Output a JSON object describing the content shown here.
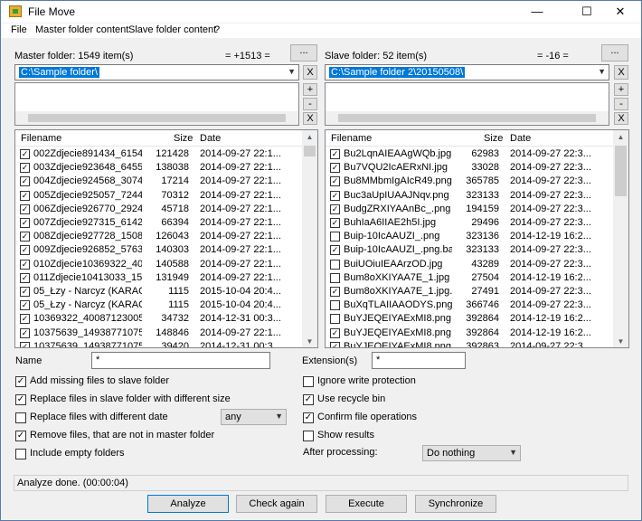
{
  "window": {
    "title": "File Move",
    "minimize": "—",
    "maximize": "☐",
    "close": "✕"
  },
  "menu": [
    "File",
    "Master folder content",
    "Slave folder content",
    "?"
  ],
  "master": {
    "label": "Master folder: 1549 item(s)",
    "diff": "= +1513 =",
    "browse": "...",
    "path": "C:\\Sample folder\\",
    "clear": "X",
    "add": "+",
    "remove": "-",
    "clear_list": "X",
    "columns": [
      "Filename",
      "Size",
      "Date"
    ],
    "rows": [
      {
        "name": "002Zdjecie891434_615438...",
        "size": "121428",
        "date": "2014-09-27 22:1...",
        "checked": true
      },
      {
        "name": "003Zdjecie923648_645541...",
        "size": "138038",
        "date": "2014-09-27 22:1...",
        "checked": true
      },
      {
        "name": "004Zdjecie924568_307462...",
        "size": "17214",
        "date": "2014-09-27 22:1...",
        "checked": true
      },
      {
        "name": "005Zdjecie925057_724465...",
        "size": "70312",
        "date": "2014-09-27 22:1...",
        "checked": true
      },
      {
        "name": "006Zdjecie926770_292458...",
        "size": "45718",
        "date": "2014-09-27 22:1...",
        "checked": true
      },
      {
        "name": "007Zdjecie927315_614202...",
        "size": "66394",
        "date": "2014-09-27 22:1...",
        "checked": true
      },
      {
        "name": "008Zdjecie927728_150864...",
        "size": "126043",
        "date": "2014-09-27 22:1...",
        "checked": true
      },
      {
        "name": "009Zdjecie926852_576333...",
        "size": "140303",
        "date": "2014-09-27 22:1...",
        "checked": true
      },
      {
        "name": "010Zdjecie10369322_4008...",
        "size": "140588",
        "date": "2014-09-27 22:1...",
        "checked": true
      },
      {
        "name": "011Zdjecie10413033_1587...",
        "size": "131949",
        "date": "2014-09-27 22:1...",
        "checked": true
      },
      {
        "name": "05_Łzy - Narcyz (KARAOK...",
        "size": "1115",
        "date": "2015-10-04 20:4...",
        "checked": true
      },
      {
        "name": "05_Łzy - Narcyz (KARAOK...",
        "size": "1115",
        "date": "2015-10-04 20:4...",
        "checked": true
      },
      {
        "name": "10369322_40087123005358...",
        "size": "34732",
        "date": "2014-12-31 00:3...",
        "checked": true
      },
      {
        "name": "10375639_14938771075139...",
        "size": "148846",
        "date": "2014-09-27 22:1...",
        "checked": true
      },
      {
        "name": "10375639_14938771075139...",
        "size": "39420",
        "date": "2014-12-31 00:3...",
        "checked": true
      }
    ]
  },
  "slave": {
    "label": "Slave folder: 52 item(s)",
    "diff": "= -16 =",
    "browse": "...",
    "path": "C:\\Sample folder 2\\20150508\\",
    "clear": "X",
    "add": "+",
    "remove": "-",
    "clear_list": "X",
    "columns": [
      "Filename",
      "Size",
      "Date"
    ],
    "rows": [
      {
        "name": "Bu2LqnAIEAAgWQb.jpg",
        "size": "62983",
        "date": "2014-09-27 22:3...",
        "checked": true
      },
      {
        "name": "Bu7VQU2IcAERxNI.jpg",
        "size": "33028",
        "date": "2014-09-27 22:3...",
        "checked": true
      },
      {
        "name": "Bu8MMbmIgAIcR49.png",
        "size": "365785",
        "date": "2014-09-27 22:3...",
        "checked": true
      },
      {
        "name": "Buc3aUpIUAAJNqv.png",
        "size": "323133",
        "date": "2014-09-27 22:3...",
        "checked": true
      },
      {
        "name": "BudgZRXIYAAnBc_.png",
        "size": "194159",
        "date": "2014-09-27 22:3...",
        "checked": true
      },
      {
        "name": "BuhIaA6IIAE2h5I.jpg",
        "size": "29496",
        "date": "2014-09-27 22:3...",
        "checked": true
      },
      {
        "name": "Buip-10IcAAUZI_.png",
        "size": "323136",
        "date": "2014-12-19 16:2...",
        "checked": false
      },
      {
        "name": "Buip-10IcAAUZI_.png.bak",
        "size": "323133",
        "date": "2014-09-27 22:3...",
        "checked": true
      },
      {
        "name": "BuiUOiuIEAArzOD.jpg",
        "size": "43289",
        "date": "2014-09-27 22:3...",
        "checked": false
      },
      {
        "name": "Bum8oXKIYAA7E_1.jpg",
        "size": "27504",
        "date": "2014-12-19 16:2...",
        "checked": false
      },
      {
        "name": "Bum8oXKIYAA7E_1.jpg.bak",
        "size": "27491",
        "date": "2014-09-27 22:3...",
        "checked": true
      },
      {
        "name": "BuXqTLAIIAAODYS.png",
        "size": "366746",
        "date": "2014-09-27 22:3...",
        "checked": false
      },
      {
        "name": "BuYJEQEIYAExMI8.png",
        "size": "392864",
        "date": "2014-12-19 16:2...",
        "checked": false
      },
      {
        "name": "BuYJEQEIYAExMI8.png.bak",
        "size": "392864",
        "date": "2014-12-19 16:2...",
        "checked": true
      },
      {
        "name": "BuYJEQEIYAExMI8.png.bak",
        "size": "392863",
        "date": "2014-09-27 22:3...",
        "checked": true
      }
    ]
  },
  "filters": {
    "name_label": "Name",
    "name_value": "*",
    "ext_label": "Extension(s)",
    "ext_value": "*"
  },
  "options_left": [
    {
      "label": "Add missing files to slave folder",
      "checked": true
    },
    {
      "label": "Replace files in slave folder with different size",
      "checked": true
    },
    {
      "label": "Replace files with different date",
      "checked": false
    },
    {
      "label": "Remove files, that are not in master folder",
      "checked": true
    },
    {
      "label": "Include empty folders",
      "checked": false
    }
  ],
  "date_mode": "any",
  "options_right": [
    {
      "label": "Ignore write protection",
      "checked": false
    },
    {
      "label": "Use recycle bin",
      "checked": true
    },
    {
      "label": "Confirm file operations",
      "checked": true
    },
    {
      "label": "Show results",
      "checked": false
    }
  ],
  "after_label": "After processing:",
  "after_value": "Do nothing",
  "status": "Analyze done. (00:00:04)",
  "buttons": {
    "analyze": "Analyze",
    "check_again": "Check again",
    "execute": "Execute",
    "synchronize": "Synchronize"
  }
}
